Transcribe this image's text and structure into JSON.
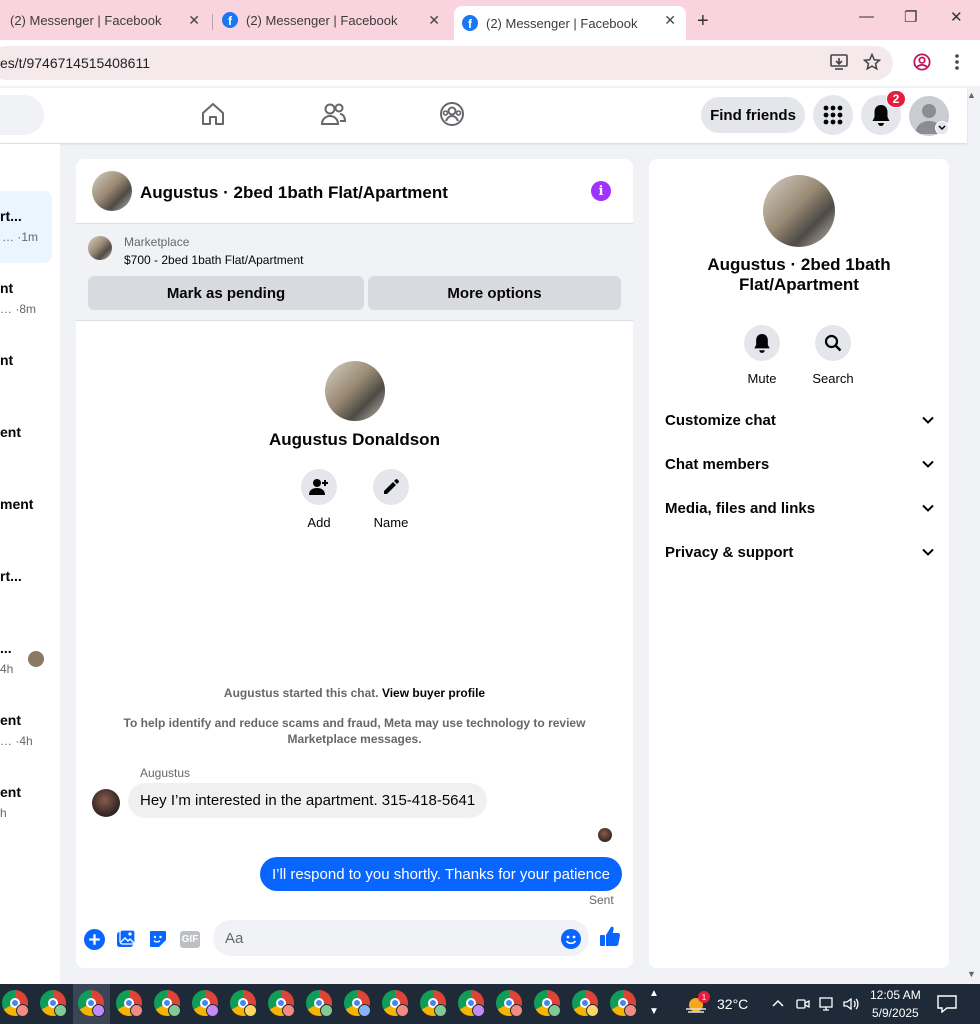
{
  "browser": {
    "tabs": [
      {
        "title": "(2) Messenger | Facebook"
      },
      {
        "title": "(2) Messenger | Facebook"
      },
      {
        "title": "(2) Messenger | Facebook"
      }
    ],
    "url": "es/t/9746714515408611"
  },
  "header": {
    "find_friends": "Find friends",
    "notification_count": "2"
  },
  "chat_list": [
    {
      "name": "rt...",
      "sub": "… ·1m"
    },
    {
      "name": "nt",
      "sub": "… ·8m"
    },
    {
      "name": "nt",
      "sub": ""
    },
    {
      "name": "ent",
      "sub": ""
    },
    {
      "name": "ment",
      "sub": ""
    },
    {
      "name": "rt...",
      "sub": ""
    },
    {
      "name": "...",
      "sub": "4h"
    },
    {
      "name": "ent",
      "sub": "… ·4h"
    },
    {
      "name": "ent",
      "sub": "h"
    }
  ],
  "chat": {
    "title": "Augustus · 2bed 1bath Flat/Apartment",
    "marketplace_label": "Marketplace",
    "listing": "$700 - 2bed 1bath Flat/Apartment",
    "mark_pending": "Mark as pending",
    "more_options": "More options",
    "profile_name": "Augustus Donaldson",
    "add_label": "Add",
    "name_label": "Name",
    "started_text": "Augustus started this chat.",
    "view_profile": "View buyer profile",
    "scam_notice": "To help identify and reduce scams and fraud, Meta may use technology to review Marketplace messages.",
    "sender_name": "Augustus",
    "incoming_message": "Hey I’m interested in the apartment. 315-418-5641",
    "outgoing_message": "I’ll respond to you shortly. Thanks for your patience",
    "sent_status": "Sent",
    "input_placeholder": "Aa",
    "gif_label": "GIF"
  },
  "info_panel": {
    "name": "Augustus · 2bed 1bath Flat/Apartment",
    "mute_label": "Mute",
    "search_label": "Search",
    "sections": [
      "Customize chat",
      "Chat members",
      "Media, files and links",
      "Privacy & support"
    ]
  },
  "taskbar": {
    "temperature": "32°C",
    "weather_badge": "1",
    "time": "12:05 AM",
    "date": "5/9/2025"
  },
  "colors": {
    "messenger_blue": "#0866ff",
    "facebook_blue": "#1877f2",
    "info_purple": "#a033ff",
    "notification_red": "#e41e3f"
  }
}
